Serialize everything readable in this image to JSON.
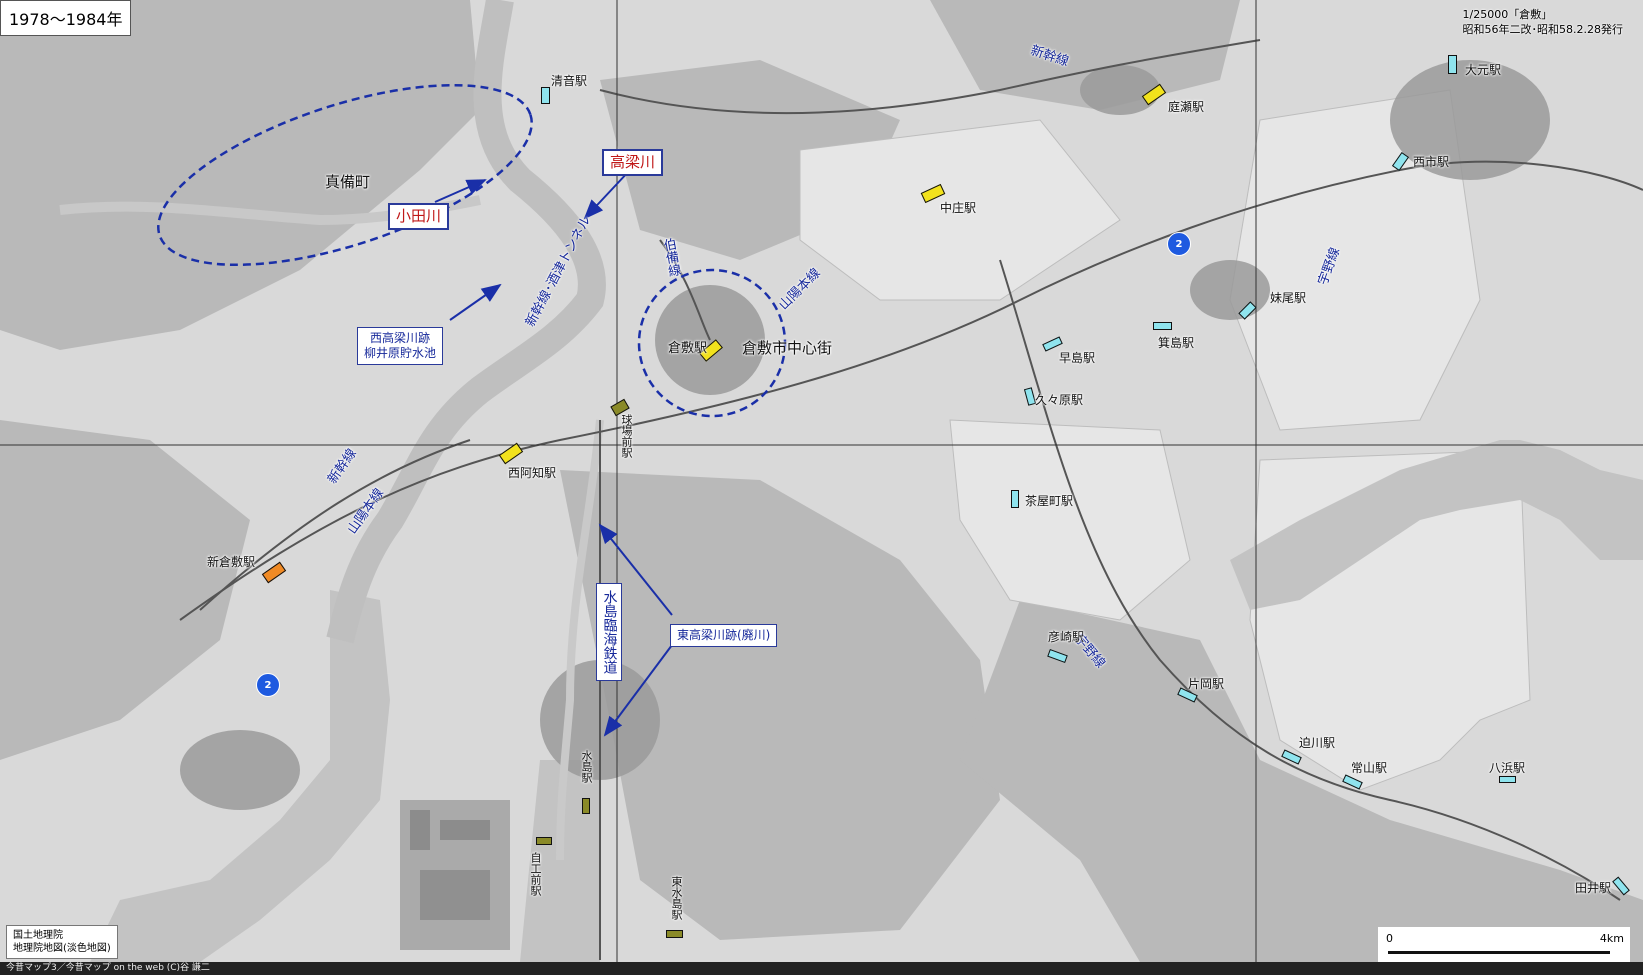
{
  "period_label": "1978〜1984年",
  "source_note": {
    "line1": "1/25000「倉敷」",
    "line2": "昭和56年二改･昭和58.2.28発行"
  },
  "attribution": {
    "line1": "国土地理院",
    "line2": "地理院地図(淡色地図)"
  },
  "footer": "今昔マップ3／今昔マップ on the web  (C)谷 謙二",
  "scale": {
    "start": "0",
    "end": "4km"
  },
  "colors": {
    "annotation_blue": "#1a2fa8",
    "highlight_red": "#c01818",
    "station_yellow": "#f2e21c",
    "station_orange": "#f08a24",
    "station_cyan": "#8fe4ee",
    "station_olive": "#8a8a28",
    "route_marker": "#1e5ae0"
  },
  "stations": [
    {
      "name": "清音駅",
      "color": "cyan"
    },
    {
      "name": "庭瀬駅",
      "color": "yellow"
    },
    {
      "name": "大元駅",
      "color": "cyan"
    },
    {
      "name": "西市駅",
      "color": "cyan"
    },
    {
      "name": "中庄駅",
      "color": "yellow"
    },
    {
      "name": "妹尾駅",
      "color": "cyan"
    },
    {
      "name": "箕島駅",
      "color": "cyan"
    },
    {
      "name": "早島駅",
      "color": "cyan"
    },
    {
      "name": "久々原駅",
      "color": "cyan"
    },
    {
      "name": "倉敷駅",
      "color": "yellow"
    },
    {
      "name": "球場前駅",
      "color": "olive"
    },
    {
      "name": "西阿知駅",
      "color": "yellow"
    },
    {
      "name": "茶屋町駅",
      "color": "cyan"
    },
    {
      "name": "新倉敷駅",
      "color": "orange"
    },
    {
      "name": "彦崎駅",
      "color": "cyan"
    },
    {
      "name": "片岡駅",
      "color": "cyan"
    },
    {
      "name": "迫川駅",
      "color": "cyan"
    },
    {
      "name": "常山駅",
      "color": "cyan"
    },
    {
      "name": "八浜駅",
      "color": "cyan"
    },
    {
      "name": "田井駅",
      "color": "cyan"
    },
    {
      "name": "水島駅",
      "color": "olive"
    },
    {
      "name": "三菱自工前駅",
      "color": "olive"
    },
    {
      "name": "東水島駅",
      "color": "olive"
    }
  ],
  "short_labels": {
    "shirako": "自工前駅",
    "higashi_mizushima": "東水島駅"
  },
  "line_labels": {
    "shinkansen_north": "新幹線",
    "shinkansen_west": "新幹線",
    "sanyo_main": "山陽本線",
    "sanyo_west": "山陽本線",
    "hakubi": "伯備線",
    "uno_north": "宇野線",
    "uno_south": "宇野線",
    "tunnel": "新幹線･酒津トンネル",
    "mizushima_rinkai": "水島臨海鉄道"
  },
  "area_labels": {
    "mabi": "真備町",
    "kurashiki_center": "倉敷市中心街"
  },
  "callouts": {
    "odagawa": "小田川",
    "takahashigawa": "高梁川",
    "nishi_takahashi_line1": "西高梁川跡",
    "nishi_takahashi_line2": "柳井原貯水池",
    "higashi_takahashi": "東高梁川跡(廃川)"
  },
  "route_markers": [
    "2",
    "2"
  ]
}
